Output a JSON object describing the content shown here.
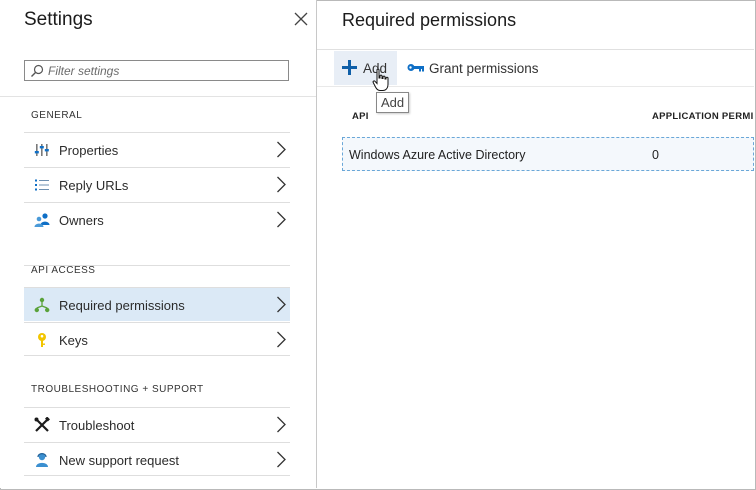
{
  "settings": {
    "title": "Settings",
    "filter_placeholder": "Filter settings",
    "sections": {
      "general": "GENERAL",
      "api_access": "API ACCESS",
      "troubleshooting": "TROUBLESHOOTING + SUPPORT"
    },
    "items": [
      {
        "label": "Properties"
      },
      {
        "label": "Reply URLs"
      },
      {
        "label": "Owners"
      },
      {
        "label": "Required permissions"
      },
      {
        "label": "Keys"
      },
      {
        "label": "Troubleshoot"
      },
      {
        "label": "New support request"
      }
    ]
  },
  "permissions": {
    "title": "Required permissions",
    "toolbar": {
      "add_label": "Add",
      "grant_label": "Grant permissions",
      "tooltip": "Add"
    },
    "columns": {
      "api": "API",
      "application": "APPLICATION PERMI"
    },
    "rows": [
      {
        "api": "Windows Azure Active Directory",
        "application_permissions": "0"
      }
    ]
  },
  "colors": {
    "selected_item_bg": "#dbe9f6",
    "accent_blue": "#0f6fc6",
    "add_button_bg": "#e8eef6"
  }
}
